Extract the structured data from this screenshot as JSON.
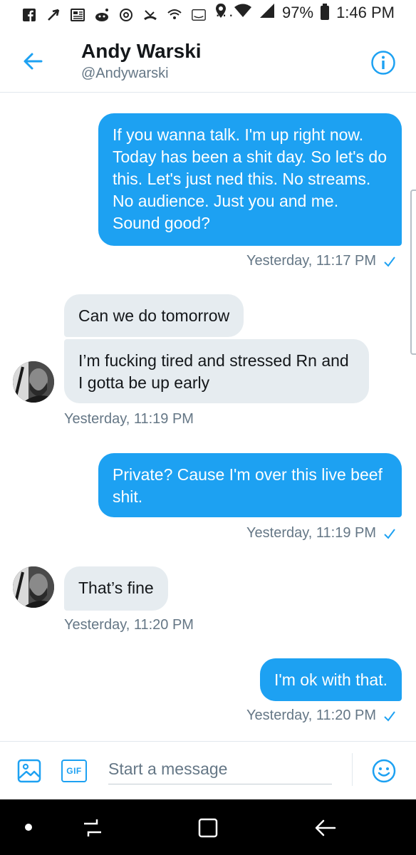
{
  "status_bar": {
    "battery": "97%",
    "time": "1:46 PM",
    "dots": "···"
  },
  "header": {
    "name": "Andy Warski",
    "handle": "@Andywarski"
  },
  "messages": [
    {
      "from": "me",
      "text": "If you wanna talk. I'm up right now. Today has been a shit day. So let's do this. Let's just ned this. No streams. No audience. Just you and me. Sound good?"
    },
    {
      "time": "Yesterday, 11:17 PM"
    },
    {
      "from": "them",
      "text": "Can we do tomorrow"
    },
    {
      "from": "them",
      "text": "I’m fucking tired and stressed Rn and I gotta be up early"
    },
    {
      "time": "Yesterday, 11:19 PM"
    },
    {
      "from": "me",
      "text": "Private? Cause I'm over this live beef shit."
    },
    {
      "time": "Yesterday, 11:19 PM"
    },
    {
      "from": "them",
      "text": "That’s fine"
    },
    {
      "time": "Yesterday, 11:20 PM"
    },
    {
      "from": "me",
      "text": "I'm ok with that."
    },
    {
      "time": "Yesterday, 11:20 PM"
    }
  ],
  "composer": {
    "placeholder": "Start a message",
    "gif_label": "GIF"
  },
  "colors": {
    "accent": "#1da1f2",
    "received_bubble": "#e6ecf0",
    "secondary_text": "#657786"
  }
}
